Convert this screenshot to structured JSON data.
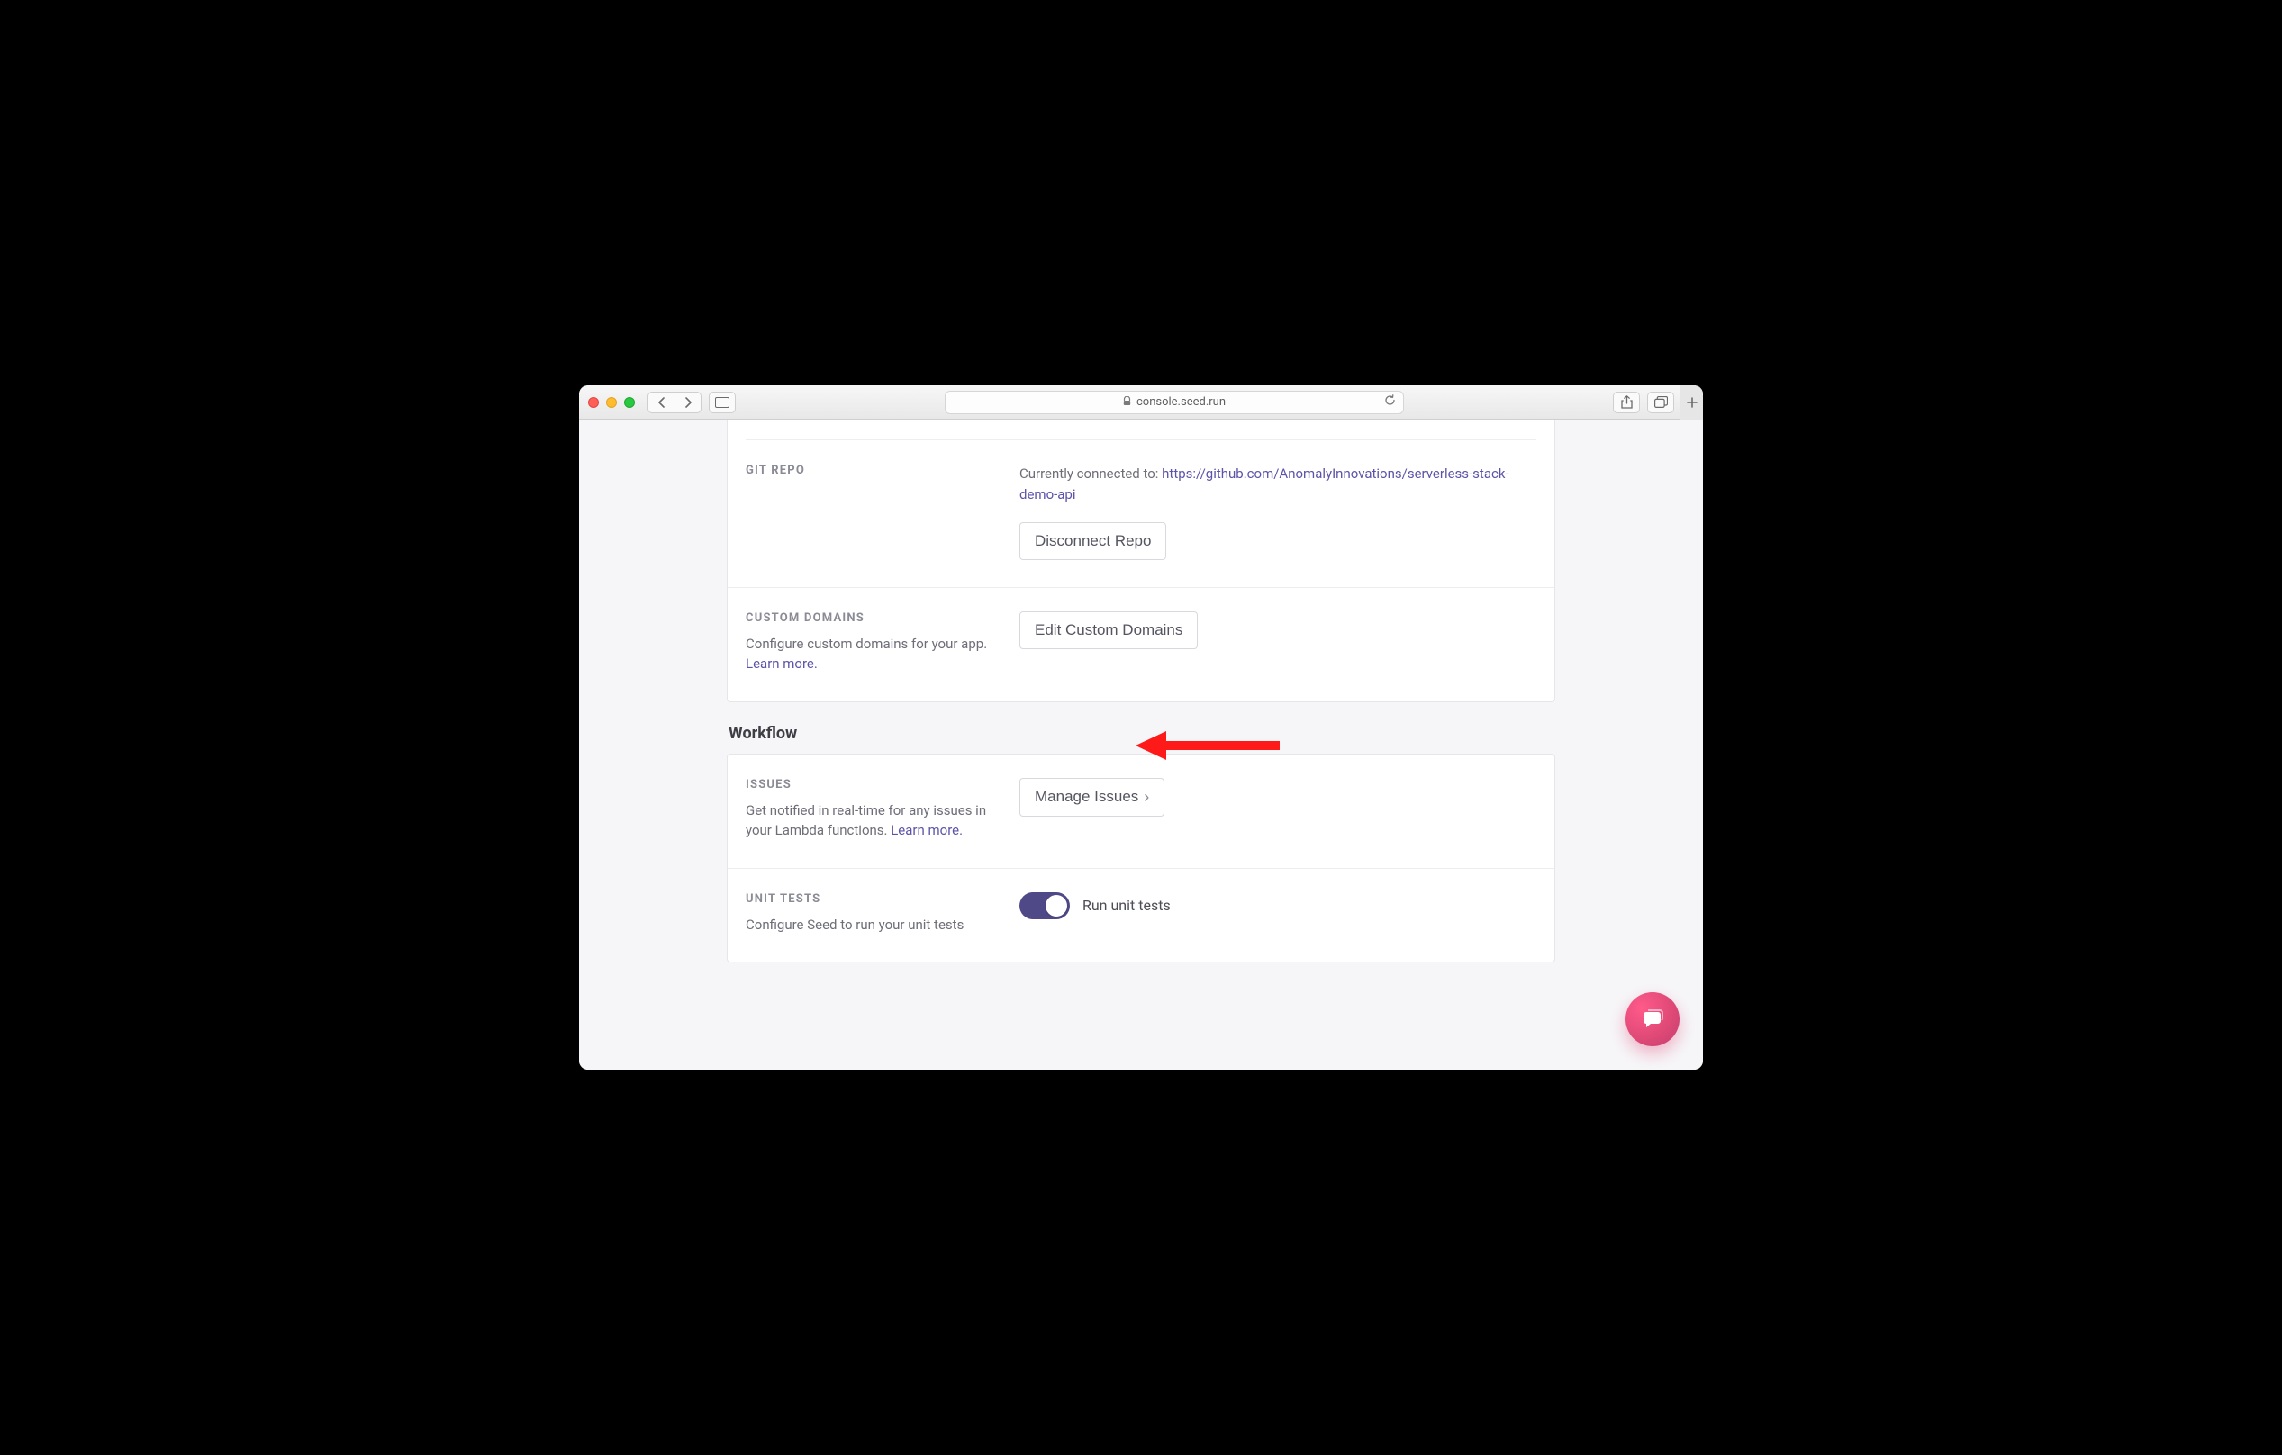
{
  "browser": {
    "url_display": "console.seed.run"
  },
  "settings": {
    "git_repo": {
      "title": "GIT REPO",
      "connected_prefix": "Currently connected to: ",
      "repo_url": "https://github.com/AnomalyInnovations/serverless-stack-demo-api",
      "disconnect_label": "Disconnect Repo"
    },
    "custom_domains": {
      "title": "CUSTOM DOMAINS",
      "desc": "Configure custom domains for your app. ",
      "learn_more": "Learn more.",
      "edit_label": "Edit Custom Domains"
    }
  },
  "workflow": {
    "heading": "Workflow",
    "issues": {
      "title": "ISSUES",
      "desc": "Get notified in real-time for any issues in your Lambda functions. ",
      "learn_more": "Learn more.",
      "manage_label": "Manage Issues"
    },
    "unit_tests": {
      "title": "UNIT TESTS",
      "desc": "Configure Seed to run your unit tests",
      "toggle_label": "Run unit tests",
      "enabled": true
    }
  }
}
